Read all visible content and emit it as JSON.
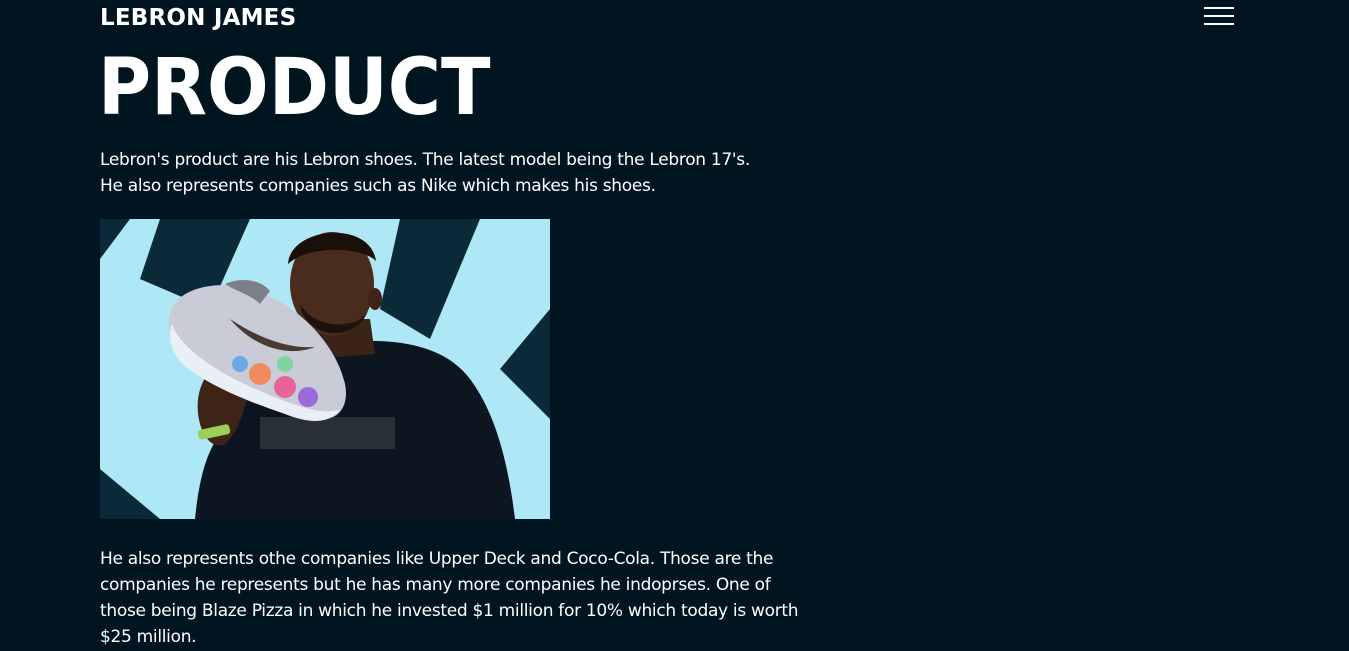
{
  "header": {
    "brand": "LEBRON JAMES",
    "menu_icon": "hamburger-menu-icon"
  },
  "section": {
    "title": "PRODUCT",
    "paragraph_1_line_1": "Lebron's product are his Lebron shoes. The latest model being the Lebron 17's.",
    "paragraph_1_line_2": "He also represents companies such as Nike which makes his shoes.",
    "paragraph_2": "He also represents othe companies like Upper Deck and Coco-Cola. Those are the companies he represents but he has many more companies he indoprses. One of those being Blaze Pizza in which he invested $1 million for 10% which today is worth $25 million."
  },
  "colors": {
    "background": "#011520",
    "text": "#ffffff",
    "photo_sky": "#aee8f6"
  }
}
